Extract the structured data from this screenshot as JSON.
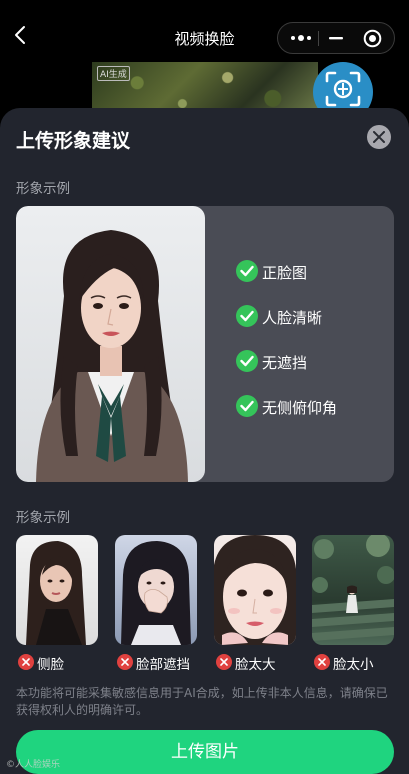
{
  "nav": {
    "title": "视频换脸"
  },
  "preview": {
    "ai_tag": "AI生成"
  },
  "sheet": {
    "title": "上传形象建议",
    "good_section_label": "形象示例",
    "good_checks": [
      "正脸图",
      "人脸清晰",
      "无遮挡",
      "无侧俯仰角"
    ],
    "bad_section_label": "形象示例",
    "bad_examples": [
      "侧脸",
      "脸部遮挡",
      "脸太大",
      "脸太小"
    ],
    "disclaimer": "本功能将可能采集敏感信息用于AI合成，如上传非本人信息，请确保已获得权利人的明确许可。",
    "upload_label": "上传图片",
    "watermark": "©人人脸娱乐"
  },
  "colors": {
    "sheet_bg": "#22252e",
    "accent_green": "#1fd47f",
    "check_green": "#35c45a",
    "reject_red": "#e0413f"
  }
}
